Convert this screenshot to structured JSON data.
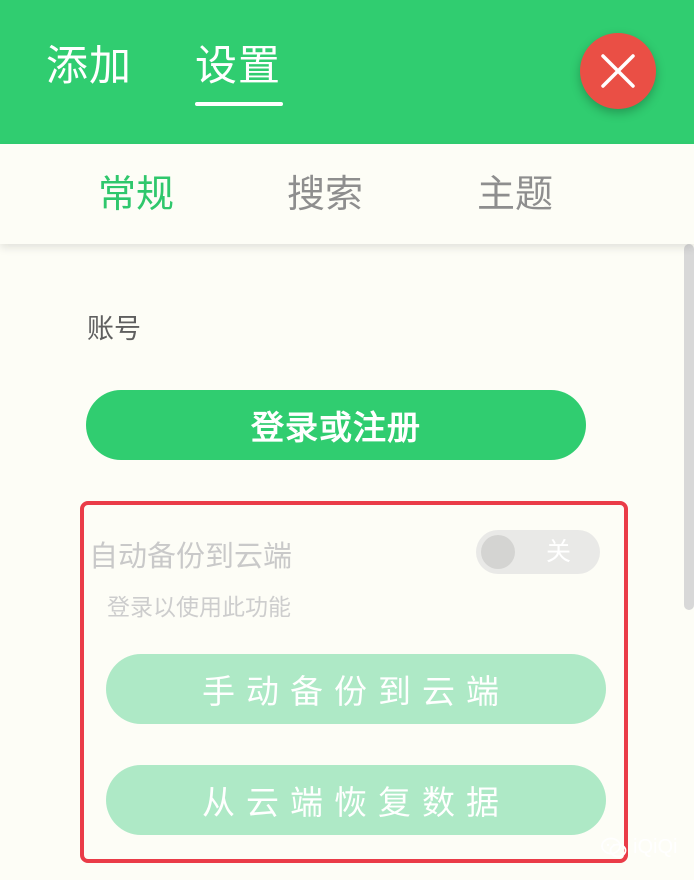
{
  "header": {
    "tabs": [
      {
        "label": "添加",
        "active": false
      },
      {
        "label": "设置",
        "active": true
      }
    ]
  },
  "subnav": {
    "tabs": [
      {
        "label": "常规",
        "active": true
      },
      {
        "label": "搜索",
        "active": false
      },
      {
        "label": "主题",
        "active": false
      }
    ]
  },
  "account": {
    "section_label": "账号",
    "login_button": "登录或注册"
  },
  "backup": {
    "auto_backup_label": "自动备份到云端",
    "toggle_state_label": "关",
    "toggle_on": false,
    "hint": "登录以使用此功能",
    "manual_backup_button": "手动备份到云端",
    "restore_button": "从云端恢复数据"
  },
  "watermark": {
    "text": "iQiQi",
    "icon": "wechat-icon"
  },
  "colors": {
    "primary_green": "#30cd70",
    "disabled_green": "#aee9c6",
    "close_red": "#ea4f45",
    "highlight_red": "#ea3c48",
    "background": "#fdfdf6"
  }
}
